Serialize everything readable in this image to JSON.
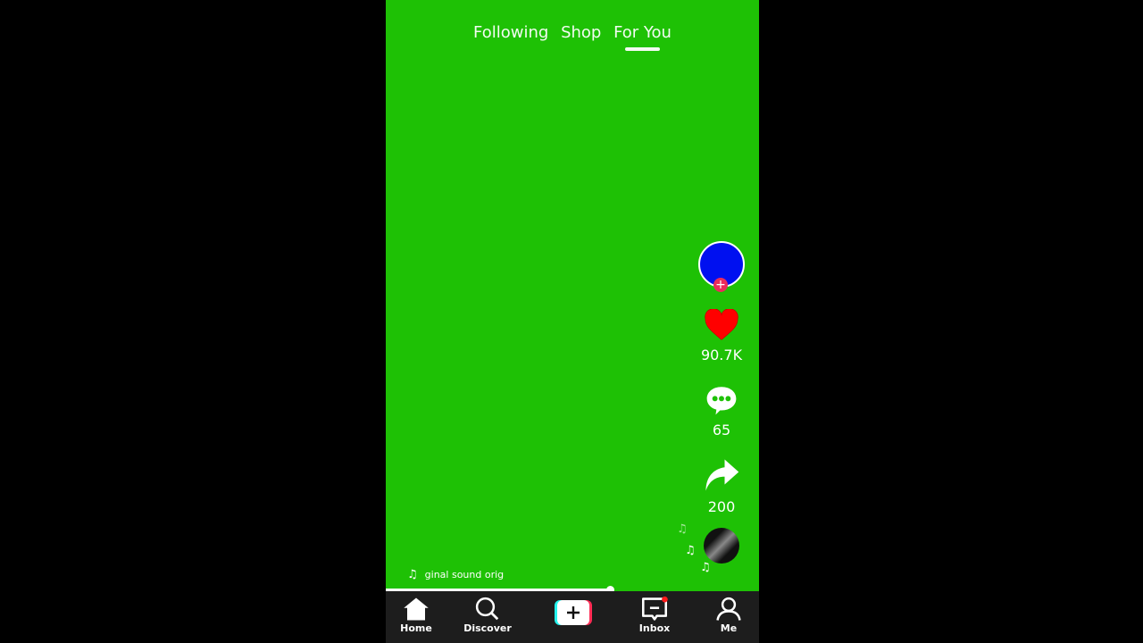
{
  "top_tabs": [
    {
      "label": "Following",
      "active": false
    },
    {
      "label": "Shop",
      "active": false
    },
    {
      "label": "For You",
      "active": true
    }
  ],
  "actions": {
    "likes": "90.7K",
    "comments": "65",
    "shares": "200"
  },
  "sound": {
    "text": "ginal sound orig"
  },
  "playback_progress": 0.6,
  "nav": {
    "home": "Home",
    "discover": "Discover",
    "inbox": "Inbox",
    "me": "Me"
  },
  "colors": {
    "background": "#1ec105",
    "avatar": "#0010f0",
    "like": "#ff0000",
    "follow": "#ea2c5b",
    "nav": "#1d1d1d"
  }
}
